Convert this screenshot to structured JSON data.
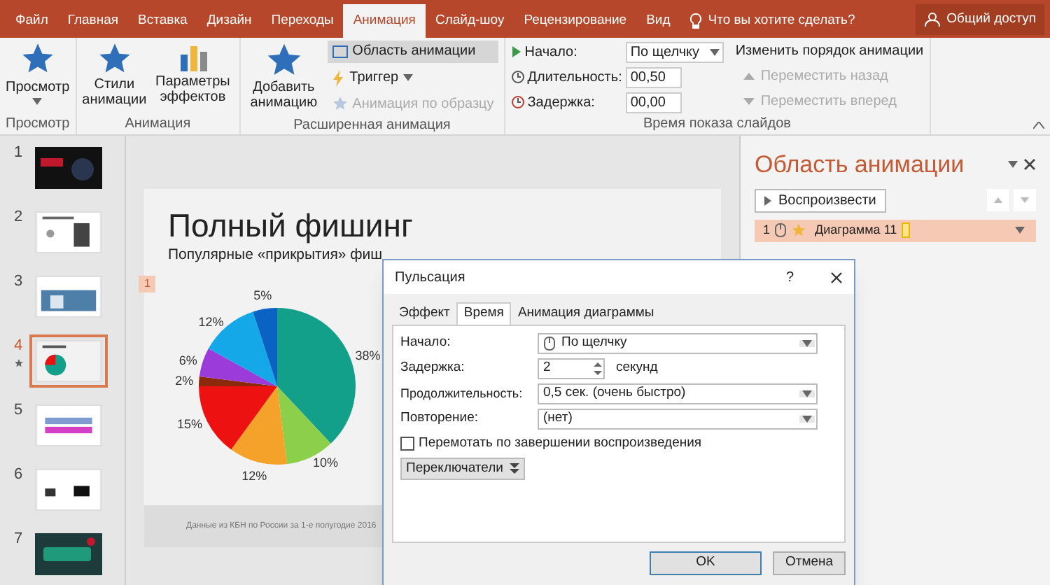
{
  "tabs": [
    {
      "label": "Файл",
      "selected": false
    },
    {
      "label": "Главная",
      "selected": false
    },
    {
      "label": "Вставка",
      "selected": false
    },
    {
      "label": "Дизайн",
      "selected": false
    },
    {
      "label": "Переходы",
      "selected": false
    },
    {
      "label": "Анимация",
      "selected": true
    },
    {
      "label": "Слайд-шоу",
      "selected": false
    },
    {
      "label": "Рецензирование",
      "selected": false
    },
    {
      "label": "Вид",
      "selected": false
    }
  ],
  "tell_me": "Что вы хотите сделать?",
  "share": "Общий доступ",
  "ribbon": {
    "preview": {
      "button": "Просмотр",
      "group": "Просмотр"
    },
    "animation": {
      "styles": "Стили анимации",
      "effects": "Параметры эффектов",
      "group": "Анимация"
    },
    "advanced": {
      "add": "Добавить анимацию",
      "pane": {
        "label": "Область анимации",
        "selected": true
      },
      "trigger": "Триггер",
      "painter": {
        "label": "Анимация по образцу",
        "disabled": true
      },
      "group": "Расширенная анимация"
    },
    "timing": {
      "start_label": "Начало:",
      "start_value": "По щелчку",
      "duration_label": "Длительность:",
      "duration_value": "00,50",
      "delay_label": "Задержка:",
      "delay_value": "00,00",
      "reorder": "Изменить порядок анимации",
      "move_back": {
        "label": "Переместить назад",
        "disabled": true
      },
      "move_forward": {
        "label": "Переместить вперед",
        "disabled": true
      },
      "group": "Время показа слайдов"
    }
  },
  "slides": [
    {
      "number": "1",
      "selected": false,
      "animated": false
    },
    {
      "number": "2",
      "selected": false,
      "animated": false
    },
    {
      "number": "3",
      "selected": false,
      "animated": false
    },
    {
      "number": "4",
      "selected": true,
      "animated": true
    },
    {
      "number": "5",
      "selected": false,
      "animated": false
    },
    {
      "number": "6",
      "selected": false,
      "animated": false
    },
    {
      "number": "7",
      "selected": false,
      "animated": false
    }
  ],
  "slide": {
    "title": "Полный фишинг",
    "subtitle": "Популярные «прикрытия» фиш",
    "animation_tag": "1",
    "footer": "Данные из КБН по России за 1-е полугодие 2016",
    "chart_data": {
      "type": "pie",
      "values": [
        38,
        10,
        12,
        15,
        2,
        6,
        12,
        5
      ],
      "colors": [
        "#13a08a",
        "#8ccf4a",
        "#f5a22a",
        "#ee1111",
        "#8b2a0a",
        "#9b3bd9",
        "#14a8e8",
        "#0a62c2"
      ],
      "value_labels": [
        "38%",
        "10%",
        "12%",
        "15%",
        "2%",
        "6%",
        "12%",
        "5%"
      ]
    }
  },
  "animation_pane": {
    "title": "Область анимации",
    "play": "Воспроизвести",
    "items": [
      {
        "number": "1",
        "name": "Диаграмма 11",
        "selected": true
      }
    ]
  },
  "dialog": {
    "title": "Пульсация",
    "help": "?",
    "tabs": [
      {
        "label": "Эффект",
        "selected": false
      },
      {
        "label": "Время",
        "selected": true
      },
      {
        "label": "Анимация диаграммы",
        "selected": false
      }
    ],
    "start_label": "Начало:",
    "start_value": "По щелчку",
    "delay_label": "Задержка:",
    "delay_value": "2",
    "delay_unit": "секунд",
    "duration_label": "Продолжительность:",
    "duration_value": "0,5 сек. (очень быстро)",
    "repeat_label": "Повторение:",
    "repeat_value": "(нет)",
    "rewind": {
      "label": "Перемотать по завершении воспроизведения",
      "checked": false
    },
    "triggers": "Переключатели",
    "ok": "OK",
    "cancel": "Отмена"
  }
}
